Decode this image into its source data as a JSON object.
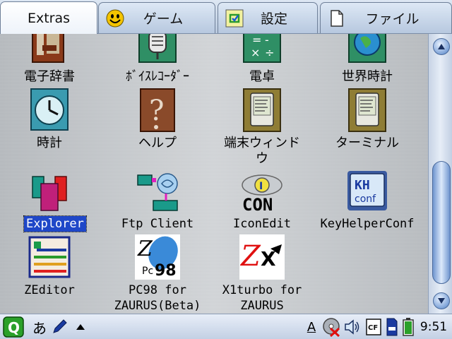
{
  "tabs": [
    {
      "label": "Extras",
      "active": true,
      "icon": "none"
    },
    {
      "label": "ゲーム",
      "active": false,
      "icon": "smiley-icon"
    },
    {
      "label": "設定",
      "active": false,
      "icon": "settings-icon"
    },
    {
      "label": "ファイル",
      "active": false,
      "icon": "file-icon"
    }
  ],
  "apps": [
    {
      "label": "電子辞書",
      "icon": "dictionary-icon"
    },
    {
      "label": "ﾎﾞｲｽﾚｺｰﾀﾞｰ",
      "icon": "voice-recorder-icon"
    },
    {
      "label": "電卓",
      "icon": "calculator-icon"
    },
    {
      "label": "世界時計",
      "icon": "world-clock-icon"
    },
    {
      "label": "時計",
      "icon": "clock-icon"
    },
    {
      "label": "ヘルプ",
      "icon": "help-icon"
    },
    {
      "label": "端末ウィンド\nウ",
      "icon": "terminal-window-icon"
    },
    {
      "label": "ターミナル",
      "icon": "terminal-icon"
    },
    {
      "label": "Explorer",
      "icon": "explorer-icon",
      "selected": true
    },
    {
      "label": "Ftp Client",
      "icon": "ftp-client-icon"
    },
    {
      "label": "IconEdit",
      "icon": "icon-edit-icon"
    },
    {
      "label": "KeyHelperConf",
      "icon": "keyhelper-conf-icon"
    },
    {
      "label": "ZEditor",
      "icon": "zeditor-icon"
    },
    {
      "label": "PC98 for\nZAURUS(Beta)",
      "icon": "pc98-icon"
    },
    {
      "label": "X1turbo for\nZAURUS",
      "icon": "x1turbo-icon"
    }
  ],
  "icon_text": {
    "iconedit_letter": "I",
    "iconedit_con": "CON",
    "keyhelper_kh": "KH",
    "keyhelper_conf": "conf",
    "pc98_z": "Z",
    "pc98_98": "98",
    "pc98_pc": "Pc",
    "x1_z": "Z",
    "x1_x": "X"
  },
  "taskbar": {
    "start": "Q",
    "input_mode": "あ",
    "underline_a": "A",
    "cf_label": "CF",
    "clock": "9:51"
  },
  "colors": {
    "selection": "#1f47c8",
    "tab_active": "#ffffff",
    "scroll_accent": "#6f95cf"
  }
}
